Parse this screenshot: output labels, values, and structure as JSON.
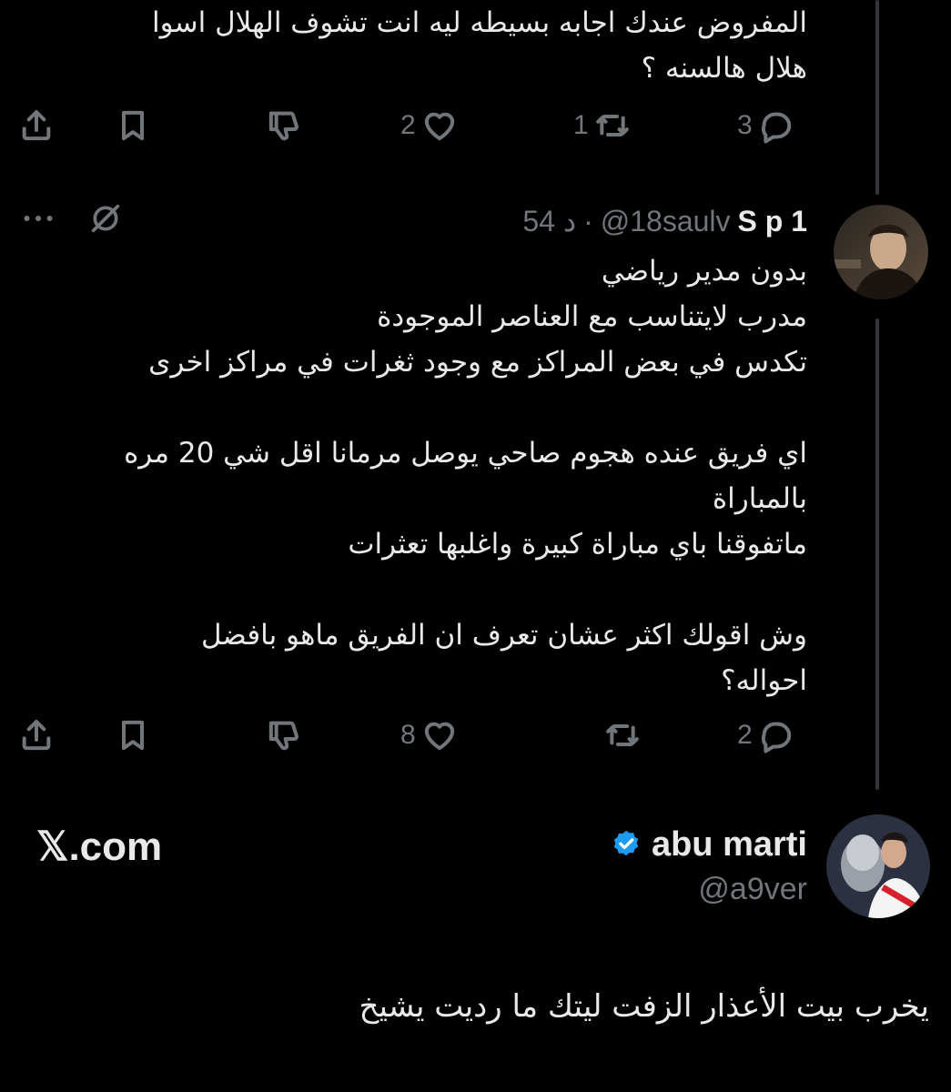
{
  "reply_1": {
    "text": "المفروض عندك اجابه بسيطه ليه انت تشوف الهلال اسوا\nهلال هالسنه ؟",
    "actions": {
      "replies": "3",
      "retweets": "1",
      "likes": "2"
    }
  },
  "reply_2": {
    "display_name": "S p 1",
    "handle": "@18saulv",
    "separator": "·",
    "time": "54 د",
    "text": "بدون مدير رياضي\nمدرب لايتناسب مع العناصر الموجودة\nتكدس في بعض المراكز مع وجود ثغرات في مراكز اخرى\n\nاي فريق عنده هجوم صاحي يوصل مرمانا اقل شي 20 مره\nبالمباراة\nماتفوقنا باي مباراة كبيرة واغلبها تعثرات\n\nوش اقولك اكثر عشان تعرف ان الفريق ماهو بافضل\nاحواله؟",
    "actions": {
      "replies": "2",
      "retweets": "",
      "likes": "8"
    }
  },
  "quote_card": {
    "display_name": "abu marti",
    "handle": "@a9ver",
    "brand": "𝕏.com",
    "verified_color": "#1d9bf0",
    "text": "يخرب بيت الأعذار الزفت ليتك ما رديت يشيخ"
  },
  "icons": {
    "reply": "reply-bubble-icon",
    "retweet": "retweet-icon",
    "like": "heart-icon",
    "dislike": "dislike-icon",
    "bookmark": "bookmark-icon",
    "share": "share-icon",
    "more": "more-dots-icon",
    "grok": "grok-icon",
    "verified": "verified-badge-icon"
  },
  "colors": {
    "background": "#000000",
    "text": "#e7e9ea",
    "muted": "#71767b",
    "thread_line": "#333639",
    "accent": "#1d9bf0"
  }
}
